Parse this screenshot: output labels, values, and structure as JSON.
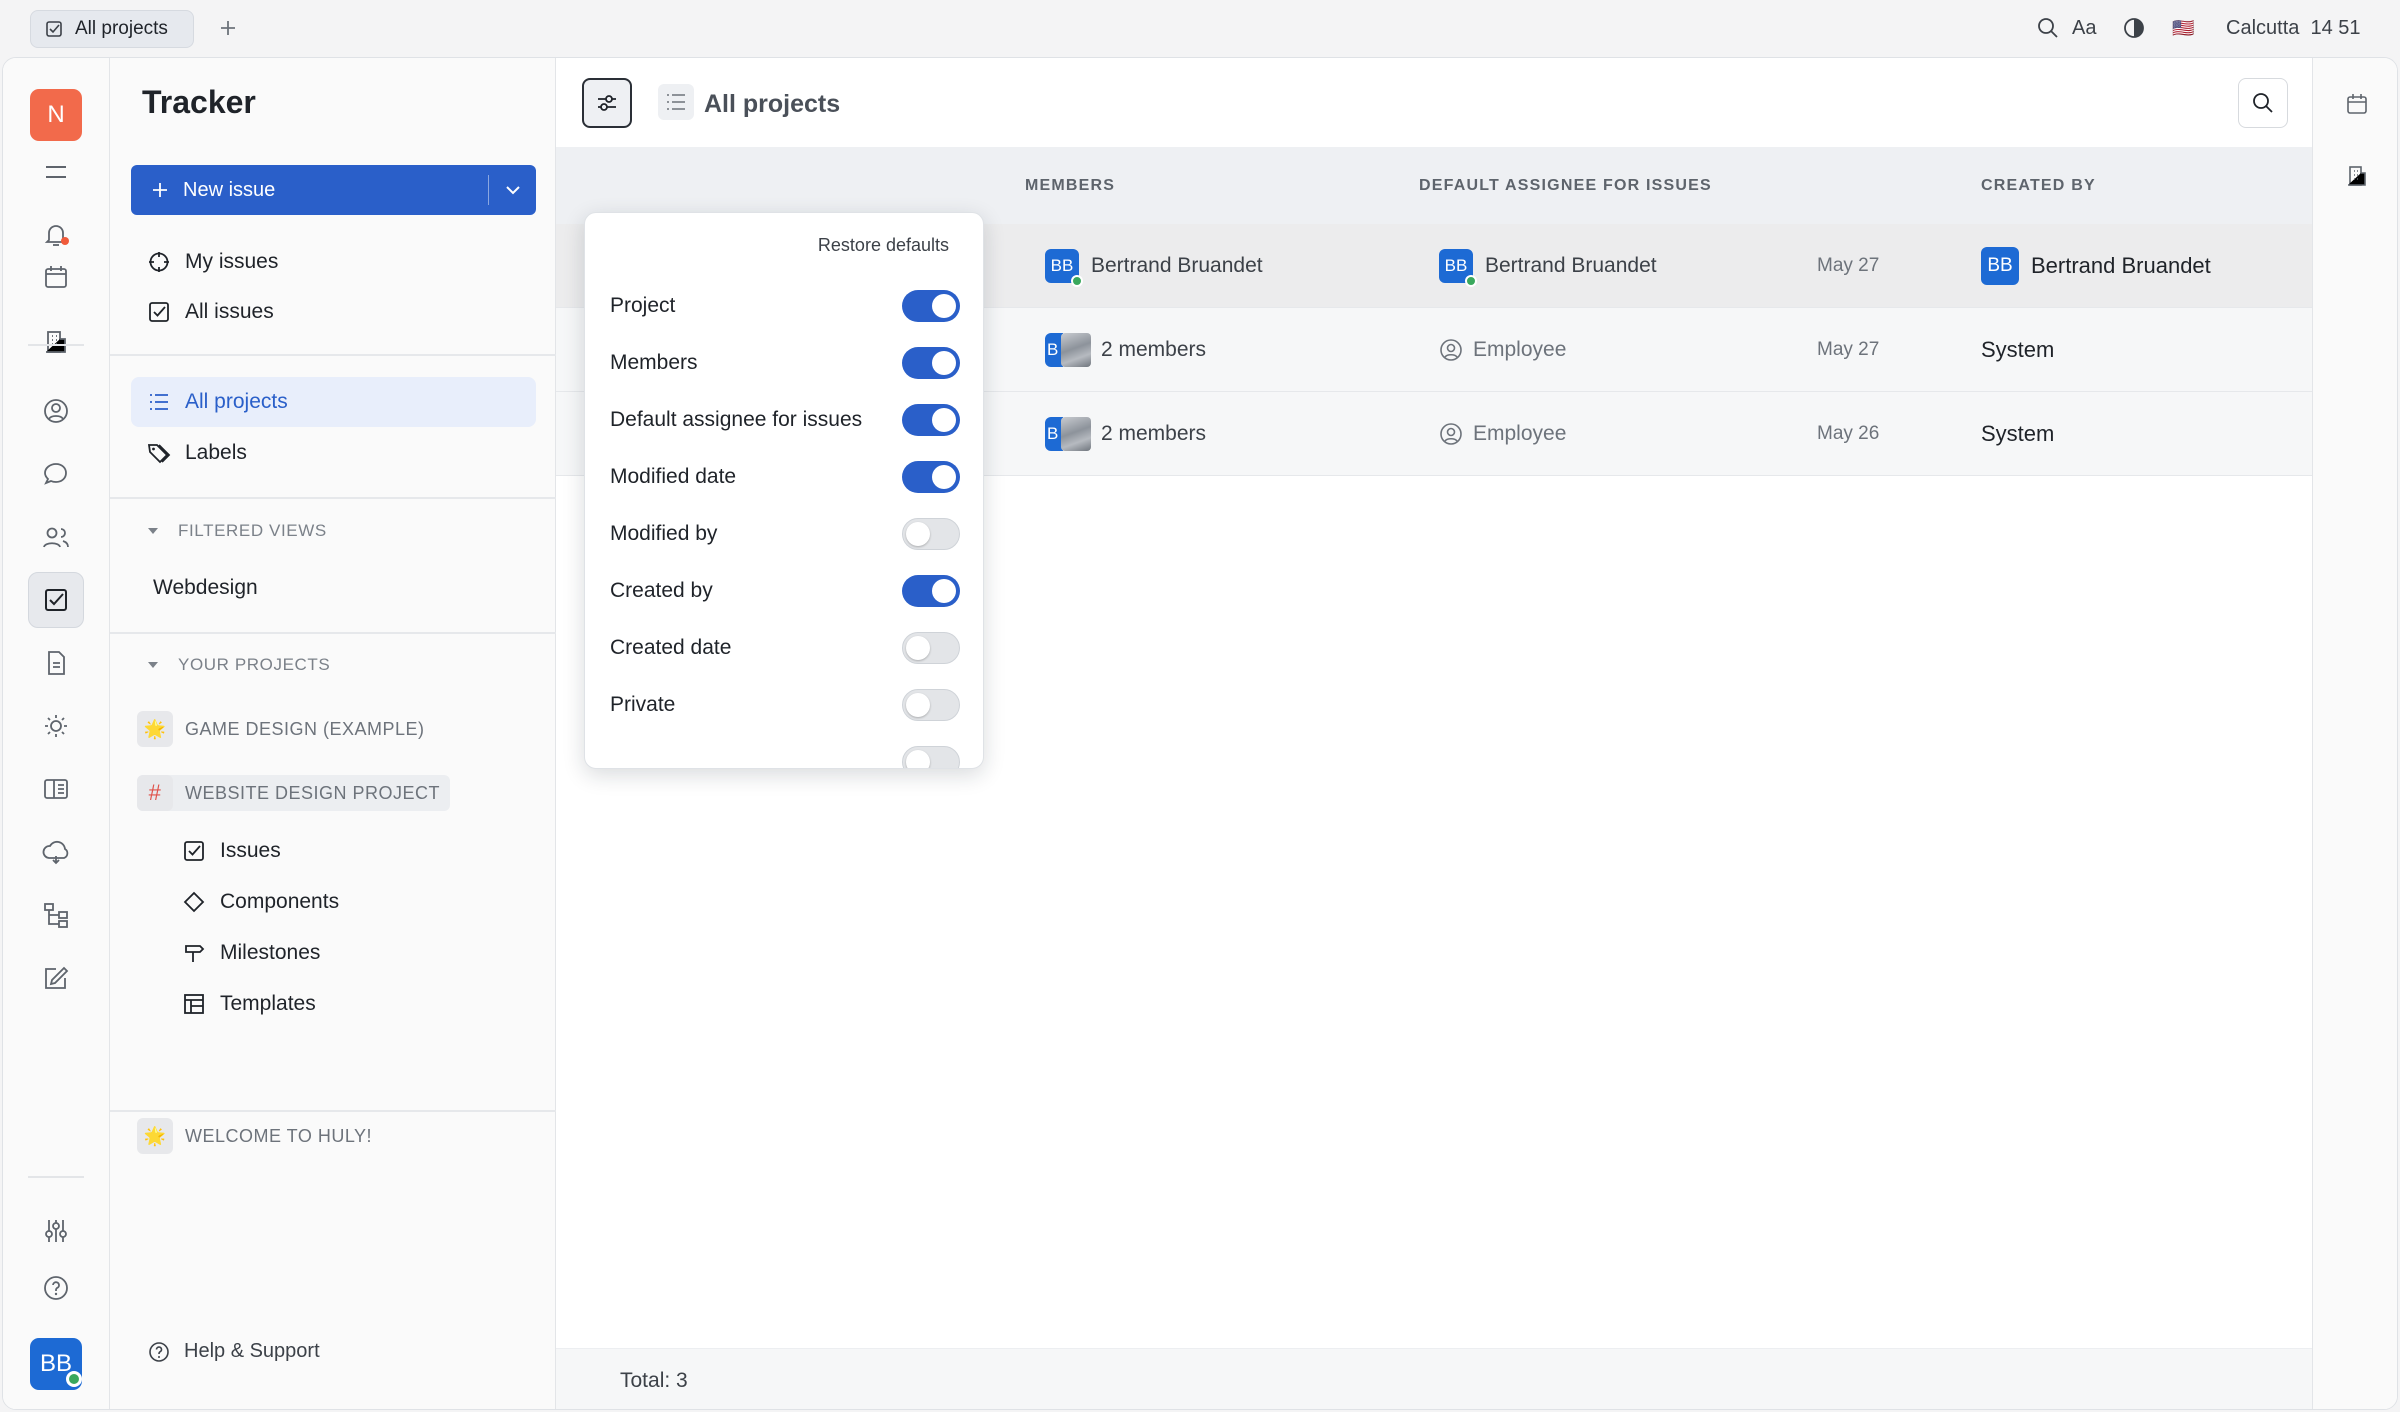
{
  "titlebar": {
    "tab_label": "All projects",
    "font_label": "Aa",
    "flag": "🇺🇸",
    "city": "Calcutta",
    "time": "14 51"
  },
  "rail": {
    "workspace_initial": "N",
    "user_initials": "BB"
  },
  "navigator": {
    "title": "Tracker",
    "new_issue": "New issue",
    "my_issues": "My issues",
    "all_issues": "All issues",
    "all_projects": "All projects",
    "labels": "Labels",
    "filtered_views_heading": "FILTERED VIEWS",
    "filtered_view_1": "Webdesign",
    "your_projects_heading": "YOUR PROJECTS",
    "projects": [
      {
        "name": "GAME DESIGN (EXAMPLE)",
        "badge": "🌟"
      },
      {
        "name": "WEBSITE DESIGN PROJECT",
        "badge": "#"
      },
      {
        "name": "WELCOME TO HULY!",
        "badge": "🌟"
      }
    ],
    "sub_items": [
      "Issues",
      "Components",
      "Milestones",
      "Templates"
    ],
    "help": "Help & Support"
  },
  "content": {
    "title": "All projects",
    "columns": {
      "members": "MEMBERS",
      "default_assignee": "DEFAULT ASSIGNEE FOR ISSUES",
      "created_by": "CREATED BY"
    },
    "rows": [
      {
        "members_initials": "BB",
        "members": "Bertrand Bruandet",
        "assignee_initials": "BB",
        "assignee": "Bertrand Bruandet",
        "modified": "May 27",
        "creator_initials": "BB",
        "created_by": "Bertrand Bruandet"
      },
      {
        "members_initials": "B",
        "members": "2 members",
        "assignee": "Employee",
        "modified": "May 27",
        "created_by": "System"
      },
      {
        "members_initials": "B",
        "members": "2 members",
        "assignee": "Employee",
        "modified": "May 26",
        "created_by": "System"
      }
    ],
    "total": "Total: 3"
  },
  "popup": {
    "restore": "Restore defaults",
    "options": [
      {
        "label": "Project",
        "on": true
      },
      {
        "label": "Members",
        "on": true
      },
      {
        "label": "Default assignee for issues",
        "on": true
      },
      {
        "label": "Modified date",
        "on": true
      },
      {
        "label": "Modified by",
        "on": false
      },
      {
        "label": "Created by",
        "on": true
      },
      {
        "label": "Created date",
        "on": false
      },
      {
        "label": "Private",
        "on": false
      }
    ]
  },
  "colors": {
    "accent": "#2a5fc9",
    "avatar": "#1d6ad4",
    "workspace": "#f26a4b",
    "online": "#3aa85d"
  }
}
